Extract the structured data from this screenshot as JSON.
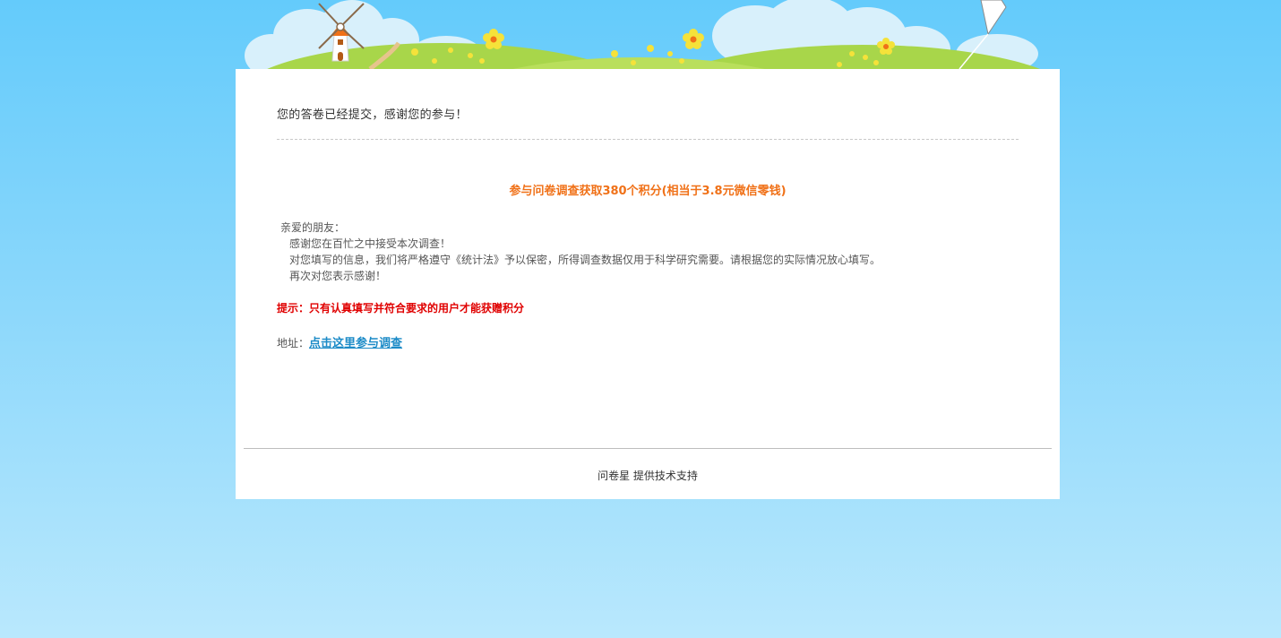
{
  "header": {
    "decor": [
      "windmill-icon",
      "flower-icon",
      "kite-icon",
      "cloud-icon",
      "hill-icon"
    ]
  },
  "main": {
    "submit_message": "您的答卷已经提交，感谢您的参与！",
    "reward_title": "参与问卷调查获取380个积分(相当于3.8元微信零钱)",
    "letter": {
      "greeting": "亲爱的朋友：",
      "line1": "感谢您在百忙之中接受本次调查！",
      "line2": "对您填写的信息，我们将严格遵守《统计法》予以保密，所得调查数据仅用于科学研究需要。请根据您的实际情况放心填写。",
      "line3": "再次对您表示感谢！"
    },
    "hint": "提示：只有认真填写并符合要求的用户才能获赠积分",
    "address_label": "地址：",
    "address_link": "点击这里参与调查"
  },
  "footer": {
    "brand": "问卷星",
    "support_text": " 提供技术支持"
  },
  "colors": {
    "sky_top": "#64cbfb",
    "sky_bottom": "#b9e8fd",
    "reward": "#f07118",
    "hint": "#e00000",
    "link": "#1c8bc7"
  }
}
